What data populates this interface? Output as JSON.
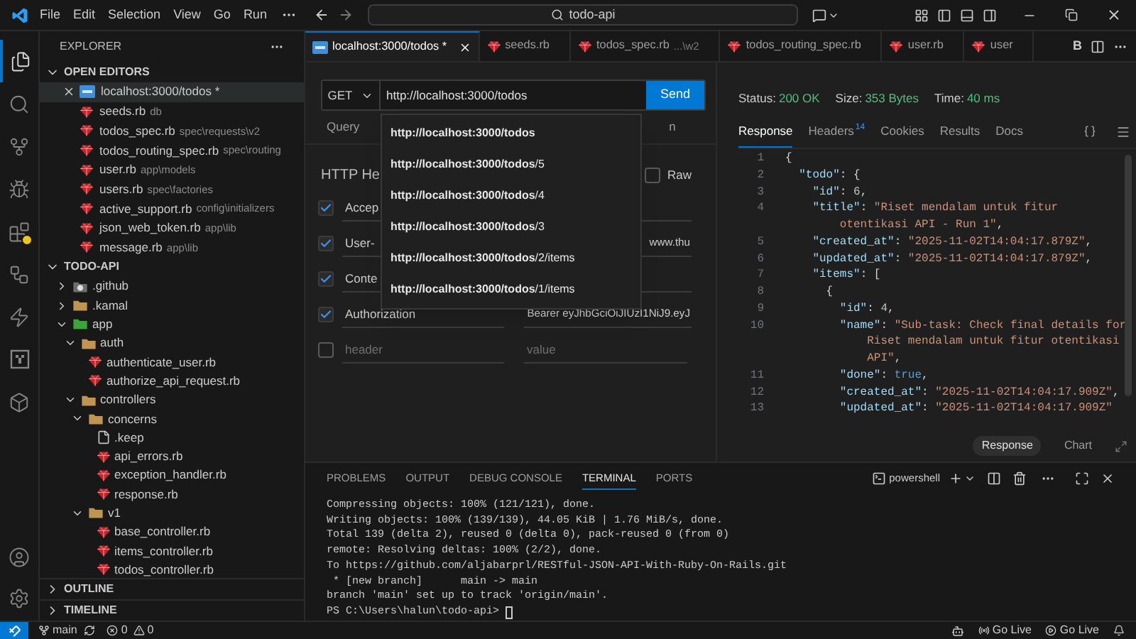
{
  "title_bar": {
    "menu": [
      "File",
      "Edit",
      "Selection",
      "View",
      "Go",
      "Run"
    ],
    "search": "todo-api"
  },
  "sidebar": {
    "title": "EXPLORER",
    "open_editors": {
      "title": "OPEN EDITORS",
      "expanded": true,
      "items": [
        {
          "name": "localhost:3000/todos *",
          "kind": "request",
          "selected": true
        },
        {
          "name": "seeds.rb",
          "path": "db",
          "kind": "ruby",
          "selected": false
        },
        {
          "name": "todos_spec.rb",
          "path": "spec\\requests\\v2",
          "kind": "ruby",
          "selected": false
        },
        {
          "name": "todos_routing_spec.rb",
          "path": "spec\\routing",
          "kind": "ruby",
          "selected": false
        },
        {
          "name": "user.rb",
          "path": "app\\models",
          "kind": "ruby",
          "selected": false
        },
        {
          "name": "users.rb",
          "path": "spec\\factories",
          "kind": "ruby",
          "selected": false
        },
        {
          "name": "active_support.rb",
          "path": "config\\initializers",
          "kind": "ruby",
          "selected": false
        },
        {
          "name": "json_web_token.rb",
          "path": "app\\lib",
          "kind": "ruby",
          "selected": false
        },
        {
          "name": "message.rb",
          "path": "app\\lib",
          "kind": "ruby",
          "selected": false
        }
      ]
    },
    "project": {
      "title": "TODO-API",
      "expanded": true,
      "tree": [
        {
          "name": ".github",
          "kind": "github_folder",
          "expanded": false
        },
        {
          "name": ".kamal",
          "kind": "folder",
          "expanded": false
        },
        {
          "name": "app",
          "kind": "app_folder",
          "expanded": true,
          "children": [
            {
              "name": "auth",
              "kind": "folder",
              "expanded": true,
              "children": [
                {
                  "name": "authenticate_user.rb",
                  "kind": "ruby"
                },
                {
                  "name": "authorize_api_request.rb",
                  "kind": "ruby"
                }
              ]
            },
            {
              "name": "controllers",
              "kind": "folder",
              "expanded": true,
              "children": [
                {
                  "name": "concerns",
                  "kind": "folder",
                  "expanded": true,
                  "children": [
                    {
                      "name": ".keep",
                      "kind": "file"
                    },
                    {
                      "name": "api_errors.rb",
                      "kind": "ruby"
                    },
                    {
                      "name": "exception_handler.rb",
                      "kind": "ruby"
                    },
                    {
                      "name": "response.rb",
                      "kind": "ruby"
                    }
                  ]
                },
                {
                  "name": "v1",
                  "kind": "folder",
                  "expanded": true,
                  "children": [
                    {
                      "name": "base_controller.rb",
                      "kind": "ruby"
                    },
                    {
                      "name": "items_controller.rb",
                      "kind": "ruby"
                    },
                    {
                      "name": "todos_controller.rb",
                      "kind": "ruby"
                    }
                  ]
                }
              ]
            }
          ]
        }
      ]
    },
    "sections": [
      {
        "title": "OUTLINE",
        "expanded": false
      },
      {
        "title": "TIMELINE",
        "expanded": false
      }
    ]
  },
  "editor_tabs": [
    {
      "label": "localhost:3000/todos *",
      "kind": "request",
      "selected": true
    },
    {
      "label": "seeds.rb",
      "kind": "ruby",
      "selected": false
    },
    {
      "label": "todos_spec.rb",
      "detail": "...\\w2",
      "kind": "ruby",
      "selected": false
    },
    {
      "label": "todos_routing_spec.rb",
      "kind": "ruby",
      "selected": false
    },
    {
      "label": "user.rb",
      "kind": "ruby",
      "selected": false
    },
    {
      "label": "user",
      "kind": "ruby",
      "selected": false
    }
  ],
  "editor_action_letter": "B",
  "request": {
    "method": "GET",
    "url": "http://localhost:3000/todos",
    "send": "Send",
    "tabs": [
      "Query",
      "n"
    ],
    "section_title": "HTTP He",
    "raw": {
      "label": "Raw",
      "checked": false
    },
    "headers": [
      {
        "checked": true,
        "name": "Accep"
      },
      {
        "checked": true,
        "name": "User-",
        "value": "www.thu"
      },
      {
        "checked": true,
        "name": "Conte"
      },
      {
        "checked": true,
        "name": "Authorization",
        "value": "Bearer eyJhbGciOiJIUzI1NiJ9.eyJ"
      },
      {
        "checked": false,
        "name_field": {
          "placeholder": "header"
        },
        "value_field": {
          "placeholder": "value"
        }
      }
    ],
    "suggestions": [
      {
        "match": "http://localhost:3000/todos"
      },
      {
        "match": "http://localhost:3000/todos",
        "rest": "/5"
      },
      {
        "match": "http://localhost:3000/todos",
        "rest": "/4"
      },
      {
        "match": "http://localhost:3000/todos",
        "rest": "/3"
      },
      {
        "match": "http://localhost:3000/todos",
        "rest": "/2/items"
      },
      {
        "match": "http://localhost:3000/todos",
        "rest": "/1/items"
      }
    ]
  },
  "response": {
    "status_label": "Status:",
    "status": "200 OK",
    "size_label": "Size:",
    "size": "353 Bytes",
    "time_label": "Time:",
    "time": "40 ms",
    "tabs": [
      {
        "label": "Response",
        "selected": true
      },
      {
        "label": "Headers",
        "count": "14",
        "selected": false
      },
      {
        "label": "Cookies",
        "selected": false
      },
      {
        "label": "Results",
        "selected": false
      },
      {
        "label": "Docs",
        "selected": false
      }
    ],
    "lines": [
      {
        "number": "1",
        "tokens": [
          {
            "kind": "p",
            "text": "{"
          }
        ]
      },
      {
        "number": "2",
        "tokens": [
          {
            "kind": "k",
            "text": "  \"todo\""
          },
          {
            "kind": "p",
            "text": ": {"
          }
        ]
      },
      {
        "number": "3",
        "tokens": [
          {
            "kind": "k",
            "text": "    \"id\""
          },
          {
            "kind": "p",
            "text": ": "
          },
          {
            "kind": "n",
            "text": "6"
          },
          {
            "kind": "p",
            "text": ","
          }
        ]
      },
      {
        "number": "4",
        "tokens": [
          {
            "kind": "k",
            "text": "    \"title\""
          },
          {
            "kind": "p",
            "text": ": "
          },
          {
            "kind": "s",
            "text": "\"Riset mendalam untuk fitur"
          }
        ]
      },
      {
        "tokens": [
          {
            "kind": "s",
            "text": "        otentikasi API - Run 1\""
          },
          {
            "kind": "p",
            "text": ","
          }
        ]
      },
      {
        "number": "5",
        "tokens": [
          {
            "kind": "k",
            "text": "    \"created_at\""
          },
          {
            "kind": "p",
            "text": ": "
          },
          {
            "kind": "s",
            "text": "\"2025-11-02T14:04:17.879Z\""
          },
          {
            "kind": "p",
            "text": ","
          }
        ]
      },
      {
        "number": "6",
        "tokens": [
          {
            "kind": "k",
            "text": "    \"updated_at\""
          },
          {
            "kind": "p",
            "text": ": "
          },
          {
            "kind": "s",
            "text": "\"2025-11-02T14:04:17.879Z\""
          },
          {
            "kind": "p",
            "text": ","
          }
        ]
      },
      {
        "number": "7",
        "tokens": [
          {
            "kind": "k",
            "text": "    \"items\""
          },
          {
            "kind": "p",
            "text": ": ["
          }
        ]
      },
      {
        "number": "8",
        "tokens": [
          {
            "kind": "p",
            "text": "      {"
          }
        ]
      },
      {
        "number": "9",
        "tokens": [
          {
            "kind": "k",
            "text": "        \"id\""
          },
          {
            "kind": "p",
            "text": ": "
          },
          {
            "kind": "n",
            "text": "4"
          },
          {
            "kind": "p",
            "text": ","
          }
        ]
      },
      {
        "number": "10",
        "tokens": [
          {
            "kind": "k",
            "text": "        \"name\""
          },
          {
            "kind": "p",
            "text": ": "
          },
          {
            "kind": "s",
            "text": "\"Sub-task: Check final details for"
          }
        ]
      },
      {
        "tokens": [
          {
            "kind": "s",
            "text": "            Riset mendalam untuk fitur otentikasi"
          }
        ]
      },
      {
        "tokens": [
          {
            "kind": "s",
            "text": "            API\""
          },
          {
            "kind": "p",
            "text": ","
          }
        ]
      },
      {
        "number": "11",
        "tokens": [
          {
            "kind": "k",
            "text": "        \"done\""
          },
          {
            "kind": "p",
            "text": ": "
          },
          {
            "kind": "b",
            "text": "true"
          },
          {
            "kind": "p",
            "text": ","
          }
        ]
      },
      {
        "number": "12",
        "tokens": [
          {
            "kind": "k",
            "text": "        \"created_at\""
          },
          {
            "kind": "p",
            "text": ": "
          },
          {
            "kind": "s",
            "text": "\"2025-11-02T14:04:17.909Z\""
          },
          {
            "kind": "p",
            "text": ","
          }
        ]
      },
      {
        "number": "13",
        "tokens": [
          {
            "kind": "k",
            "text": "        \"updated_at\""
          },
          {
            "kind": "p",
            "text": ": "
          },
          {
            "kind": "s",
            "text": "\"2025-11-02T14:04:17.909Z\""
          }
        ]
      }
    ],
    "view_buttons": [
      {
        "label": "Response",
        "selected": true
      },
      {
        "label": "Chart",
        "selected": false
      }
    ]
  },
  "panel": {
    "tabs": [
      {
        "label": "PROBLEMS",
        "selected": false
      },
      {
        "label": "OUTPUT",
        "selected": false
      },
      {
        "label": "DEBUG CONSOLE",
        "selected": false
      },
      {
        "label": "TERMINAL",
        "selected": true
      },
      {
        "label": "PORTS",
        "selected": false
      }
    ],
    "shell": "powershell",
    "lines": [
      "Compressing objects: 100% (121/121), done.",
      "Writing objects: 100% (139/139), 44.05 KiB | 1.76 MiB/s, done.",
      "Total 139 (delta 2), reused 0 (delta 0), pack-reused 0 (from 0)",
      "remote: Resolving deltas: 100% (2/2), done.",
      "To https://github.com/aljabarprl/RESTful-JSON-API-With-Ruby-On-Rails.git",
      " * [new branch]      main -> main",
      "branch 'main' set up to track 'origin/main'."
    ],
    "prompt": "PS C:\\Users\\halun\\todo-api>"
  },
  "status_bar": {
    "branch": "main",
    "errors": "0",
    "warnings": "0",
    "right": [
      {
        "label": "Go Live",
        "kind": "broadcast"
      },
      {
        "label": "Go Live",
        "kind": "play"
      }
    ]
  }
}
